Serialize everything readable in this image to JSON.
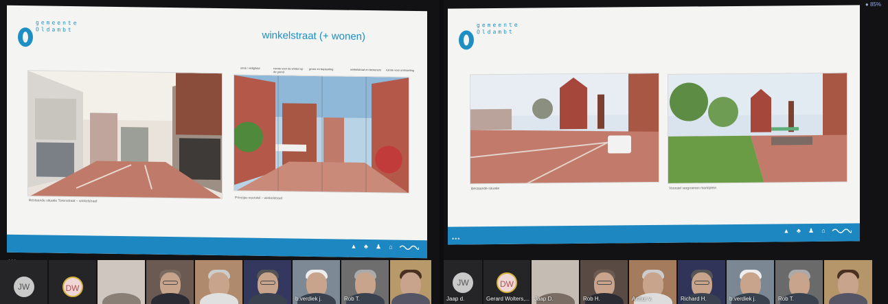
{
  "left": {
    "logo": {
      "line1": "gemeente",
      "line2": "Oldambt"
    },
    "slide_title": "winkelstraat (+ wonen)",
    "column_labels": [
      "smal / veiligheid",
      "ruimte voor de winkel op de grond",
      "groen en beplanting",
      "winkelstraat en bewoners",
      "ruimte voor ontmoeting"
    ],
    "captions": {
      "existing": "Bestaande situatie Torenstraat – winkelstraat",
      "principle": "Principe-voorstel – winkelstraat"
    },
    "menu_dots": "•••",
    "participants": [
      {
        "initials": "JW",
        "name": ""
      },
      {
        "initials": "DW",
        "name": ""
      },
      {
        "name": ""
      },
      {
        "name": ""
      },
      {
        "name": ""
      },
      {
        "name": ""
      },
      {
        "name": "b.verdiek j."
      },
      {
        "name": "Rob T."
      },
      {
        "name": ""
      }
    ]
  },
  "right": {
    "logo": {
      "line1": "gemeente",
      "line2": "Oldambt"
    },
    "captions": {
      "existing": "Bestaande situatie",
      "proposal": "Voorstel vergroenen marktplein"
    },
    "menu_dots": "•••",
    "status": "● 85%",
    "participants": [
      {
        "initials": "JW",
        "name": "Jaap d."
      },
      {
        "initials": "DW",
        "name": "Gerard Wolters,..."
      },
      {
        "name": "Jaap D."
      },
      {
        "name": "Rob H."
      },
      {
        "name": "Arthur v."
      },
      {
        "name": "Richard H."
      },
      {
        "name": "b.verdiek j."
      },
      {
        "name": "Rob T."
      },
      {
        "name": ""
      }
    ]
  },
  "colors": {
    "accent": "#1f8fc3",
    "footer": "#1c87c0",
    "brick": "#b4584a"
  },
  "footer_icons": [
    "boat-icon",
    "tree-icon",
    "person-icon",
    "house-icon",
    "wave-icon"
  ]
}
